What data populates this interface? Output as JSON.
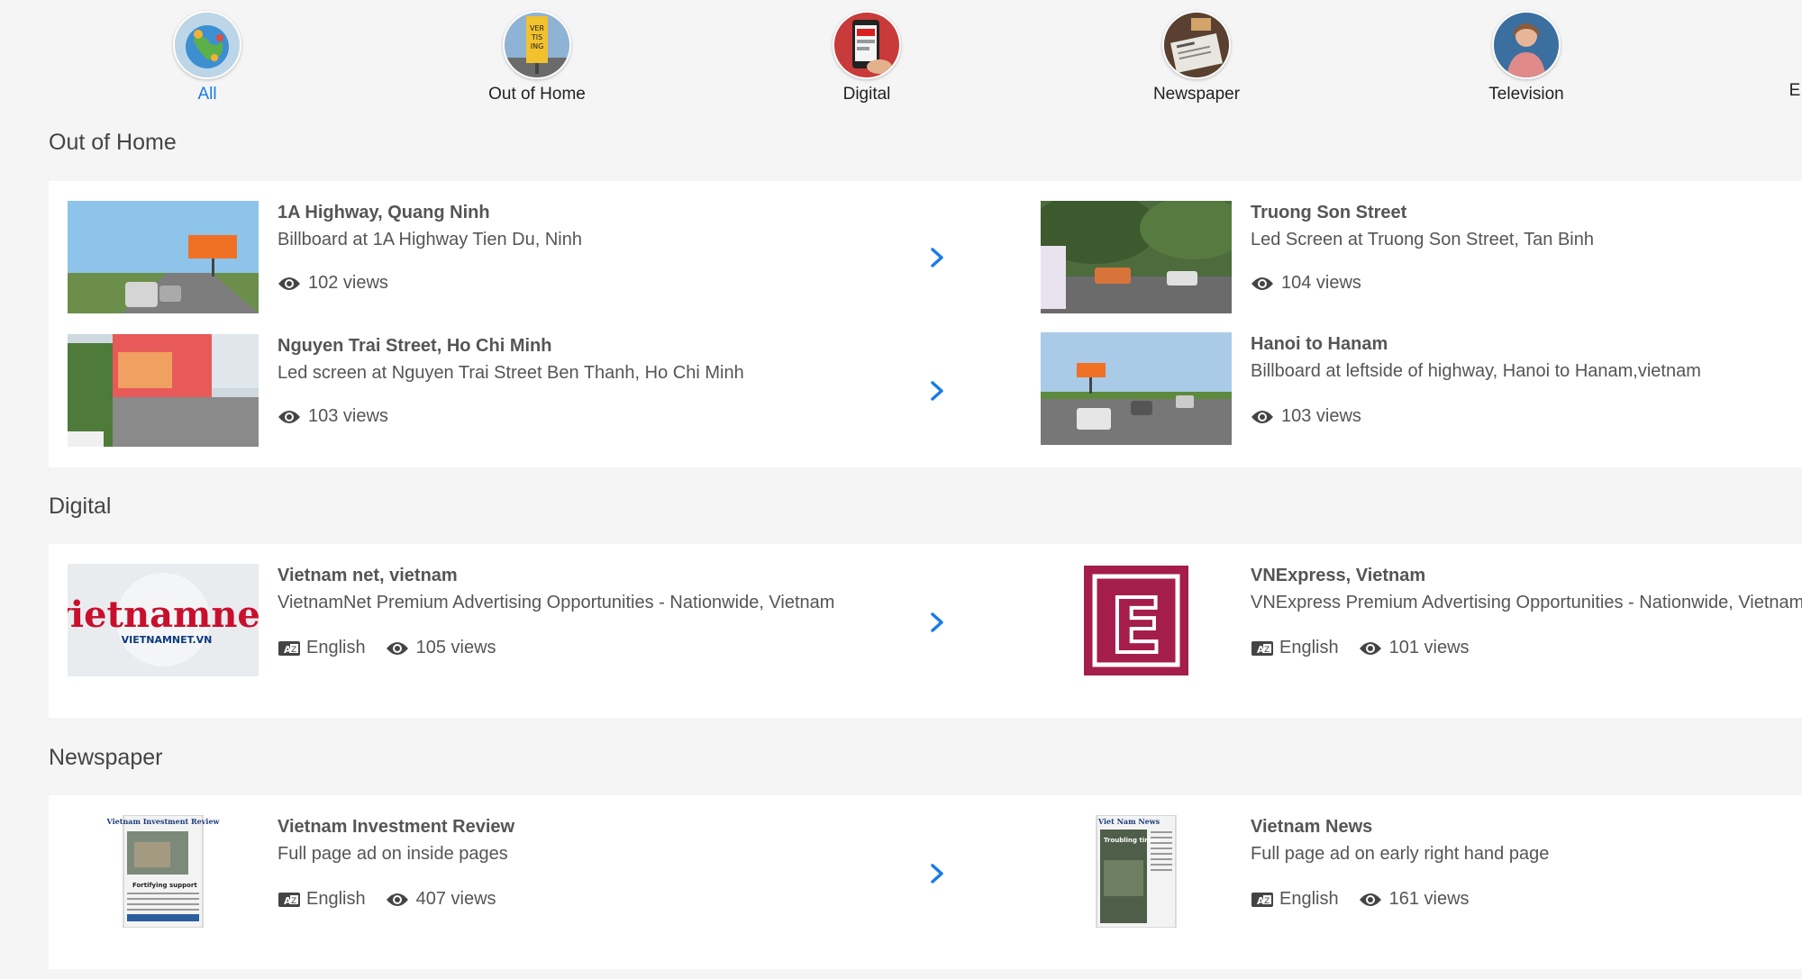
{
  "categories": [
    {
      "label": "All",
      "icon": "globe-icon",
      "active": true
    },
    {
      "label": "Out of Home",
      "icon": "advertising-board-icon",
      "active": false
    },
    {
      "label": "Digital",
      "icon": "phone-ad-icon",
      "active": false
    },
    {
      "label": "Newspaper",
      "icon": "newspaper-icon",
      "active": false
    },
    {
      "label": "Television",
      "icon": "television-presenter-icon",
      "active": false
    },
    {
      "label": "E",
      "icon": "",
      "active": false
    }
  ],
  "colors": {
    "accent": "#1a7be6",
    "card": "#ffffff",
    "page": "#f5f5f5"
  },
  "sections": [
    {
      "title": "Out of Home",
      "items": [
        {
          "title": "1A Highway, Quang Ninh",
          "subtitle": "Billboard at 1A Highway Tien Du, Ninh",
          "views": "102 views"
        },
        {
          "title": "Truong Son Street",
          "subtitle": "Led Screen at Truong Son Street, Tan Binh",
          "views": "104 views"
        },
        {
          "title": "Nguyen Trai Street, Ho Chi Minh",
          "subtitle": "Led screen at Nguyen Trai Street Ben Thanh, Ho Chi Minh",
          "views": "103 views"
        },
        {
          "title": "Hanoi to Hanam",
          "subtitle": "Billboard at leftside of highway, Hanoi to Hanam,vietnam",
          "views": "103 views"
        }
      ]
    },
    {
      "title": "Digital",
      "items": [
        {
          "title": "Vietnam net, vietnam",
          "subtitle": "VietnamNet Premium Advertising Opportunities - Nationwide, Vietnam",
          "language": "English",
          "views": "105 views",
          "logo_text": "vietnamnet",
          "logo_sub": "VIETNAMNET.VN"
        },
        {
          "title": "VNExpress, Vietnam",
          "subtitle": "VNExpress Premium Advertising Opportunities - Nationwide, Vietnam",
          "language": "English",
          "views": "101 views",
          "logo_text": "E"
        }
      ]
    },
    {
      "title": "Newspaper",
      "items": [
        {
          "title": "Vietnam Investment Review",
          "subtitle": "Full page ad on inside pages",
          "language": "English",
          "views": "407 views",
          "masthead": "Vietnam Investment Review",
          "headline": "Fortifying support"
        },
        {
          "title": "Vietnam News",
          "subtitle": "Full page ad on early right hand page",
          "language": "English",
          "views": "161 views",
          "masthead": "Viet Nam News",
          "headline": "Troubling times"
        }
      ]
    }
  ]
}
